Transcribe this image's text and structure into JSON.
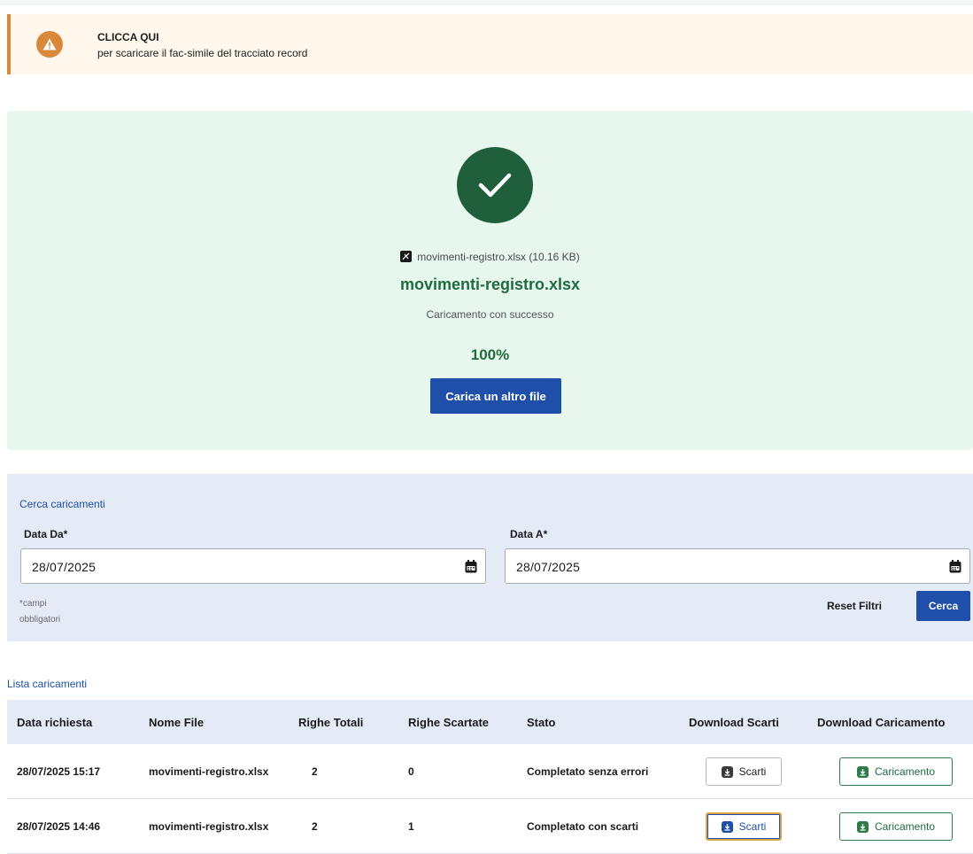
{
  "alert": {
    "title": "CLICCA QUI",
    "text": "per scaricare il fac-simile del tracciato record"
  },
  "upload": {
    "file_meta": "movimenti-registro.xlsx (10.16 KB)",
    "file_name": "movimenti-registro.xlsx",
    "status": "Caricamento con successo",
    "progress_label": "100%",
    "progress_value": 100,
    "button_label": "Carica un altro file"
  },
  "search": {
    "title": "Cerca caricamenti",
    "from_label": "Data Da*",
    "from_value": "28/07/2025",
    "to_label": "Data A*",
    "to_value": "28/07/2025",
    "required_note_line1": "*campi",
    "required_note_line2": "obbligatori",
    "reset_label": "Reset Filtri",
    "search_label": "Cerca"
  },
  "list": {
    "title": "Lista caricamenti",
    "columns": [
      "Data richiesta",
      "Nome File",
      "Righe Totali",
      "Righe Scartate",
      "Stato",
      "Download Scarti",
      "Download Caricamento"
    ],
    "rows": [
      {
        "date": "28/07/2025 15:17",
        "file": "movimenti-registro.xlsx",
        "total": "2",
        "discarded": "0",
        "state": "Completato senza errori",
        "scarti_label": "Scarti",
        "caricamento_label": "Caricamento"
      },
      {
        "date": "28/07/2025 14:46",
        "file": "movimenti-registro.xlsx",
        "total": "2",
        "discarded": "1",
        "state": "Completato con scarti",
        "scarti_label": "Scarti",
        "caricamento_label": "Caricamento"
      }
    ]
  },
  "colors": {
    "primary_blue": "#1f4fa8",
    "success_green": "#1f6b3f",
    "warning_orange": "#d9893a"
  },
  "icons": {
    "alert": "warning-triangle-icon",
    "success": "check-circle-icon",
    "file": "pdf-file-icon",
    "calendar": "calendar-icon",
    "download": "download-icon"
  }
}
